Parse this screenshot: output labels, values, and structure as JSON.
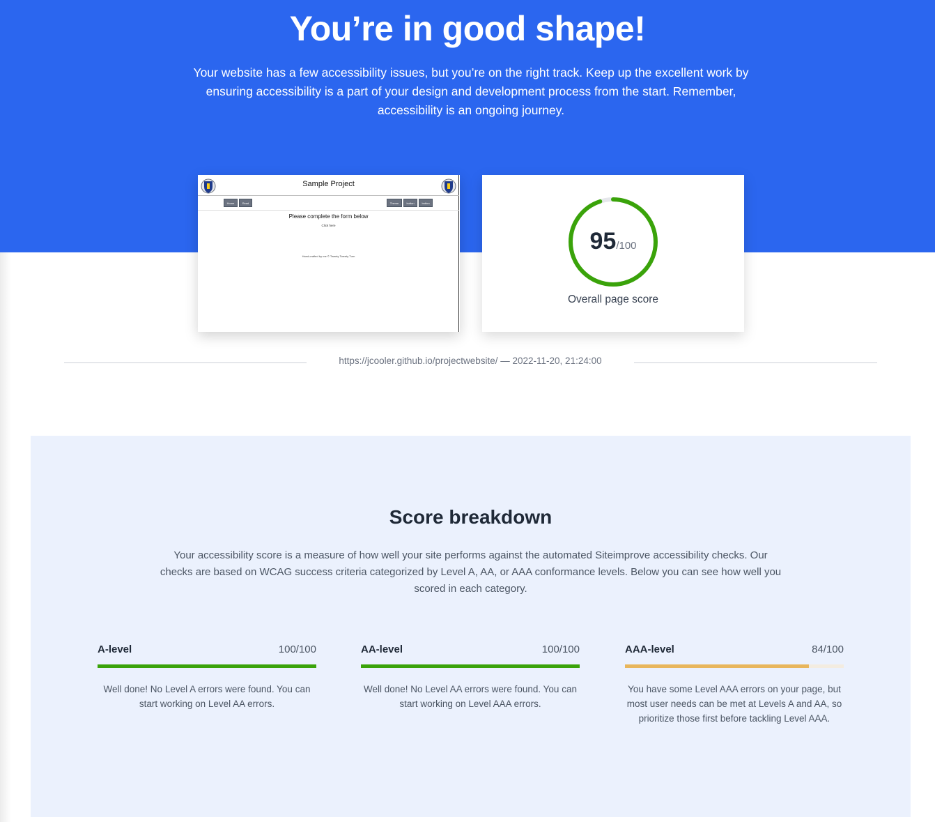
{
  "hero": {
    "title": "You’re in good shape!",
    "text": "Your website has a few accessibility issues, but you’re on the right track. Keep up the excellent work by ensuring accessibility is a part of your design and development process from the start. Remember, accessibility is an ongoing journey."
  },
  "thumbnail": {
    "title": "Sample Project",
    "buttons": [
      "Home",
      "Read",
      "Theme",
      "button",
      "button"
    ],
    "heading": "Please complete the form below",
    "small": "Click here",
    "footer": "Hand-crafted by me © Tweety Tweety Turn"
  },
  "score": {
    "value": "95",
    "max": "/100",
    "percent": 95,
    "label": "Overall page score",
    "color": "#3aa30a"
  },
  "meta": {
    "text": "https://jcooler.github.io/projectwebsite/ — 2022-11-20, 21:24:00"
  },
  "breakdown": {
    "title": "Score breakdown",
    "text": "Your accessibility score is a measure of how well your site performs against the automated Siteimprove accessibility checks. Our checks are based on WCAG success criteria categorized by Level A, AA, or AAA conformance levels. Below you can see how well you scored in each category.",
    "levels": [
      {
        "name": "A-level",
        "score": "100/100",
        "percent": 100,
        "color": "#3aa30a",
        "text": "Well done! No Level A errors were found. You can start working on Level AA errors."
      },
      {
        "name": "AA-level",
        "score": "100/100",
        "percent": 100,
        "color": "#3aa30a",
        "text": "Well done! No Level AA errors were found. You can start working on Level AAA errors."
      },
      {
        "name": "AAA-level",
        "score": "84/100",
        "percent": 84,
        "color": "#e8b65c",
        "text": "You have some Level AAA errors on your page, but most user needs can be met at Levels A and AA, so prioritize those first before tackling Level AAA."
      }
    ]
  }
}
